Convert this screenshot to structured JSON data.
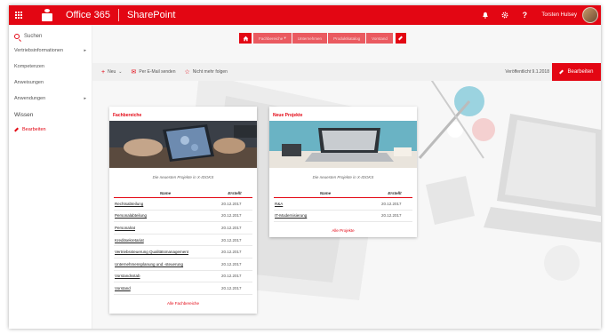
{
  "suitebar": {
    "title": "Office 365",
    "app": "SharePoint",
    "bell_icon": "bell-icon",
    "gear_icon": "gear-icon",
    "help_label": "?",
    "user_name": "Torsten Hulsey"
  },
  "leftnav": {
    "search_label": "Suchen",
    "items": [
      {
        "label": "Vertriebsinformationen",
        "has_children": true
      },
      {
        "label": "Kompetenzen",
        "has_children": false
      },
      {
        "label": "Anweisungen",
        "has_children": false
      },
      {
        "label": "Anwendungen",
        "has_children": true
      },
      {
        "label": "Wissen",
        "has_children": false
      }
    ],
    "edit_label": "Bearbeiten"
  },
  "topnav": {
    "items": [
      "Fachbereiche",
      "Unternehmen",
      "Produktkatalog",
      "Vorstand"
    ]
  },
  "cmdbar": {
    "new_label": "Neu",
    "email_label": "Per E-Mail senden",
    "follow_label": "Nicht mehr folgen",
    "published": "Veröffentlicht 9.1.2018",
    "edit_label": "Bearbeiten"
  },
  "card1": {
    "title": "Fachbereiche",
    "subtitle": "Die neuesten Projekte in X-IDOKS",
    "col_name": "Name",
    "col_date": "Erstellt",
    "rows": [
      {
        "name": "Rechtsabteilung",
        "date": "20.12.2017"
      },
      {
        "name": "Personalabteilung",
        "date": "20.12.2017"
      },
      {
        "name": "Personalrat",
        "date": "20.12.2017"
      },
      {
        "name": "Kreditsekretariat",
        "date": "20.12.2017"
      },
      {
        "name": "Vertriebssteuerung Qualitätsmanagement",
        "date": "20.12.2017"
      },
      {
        "name": "Unternehmensplanung und -steuerung",
        "date": "20.12.2017"
      },
      {
        "name": "Vorstandsstab",
        "date": "20.12.2017"
      },
      {
        "name": "Vorstand",
        "date": "20.12.2017"
      }
    ],
    "all_link": "Alle Fachbereiche"
  },
  "card2": {
    "title": "Neue Projekte",
    "subtitle": "Die neuesten Projekte in X-IDOKS",
    "col_name": "Name",
    "col_date": "Erstellt",
    "rows": [
      {
        "name": "R&A",
        "date": "20.12.2017"
      },
      {
        "name": "IT-Modernisierung",
        "date": "20.12.2017"
      }
    ],
    "all_link": "Alle Projekte"
  },
  "colors": {
    "brand": "#e30613",
    "background": "#f7f7f7"
  }
}
